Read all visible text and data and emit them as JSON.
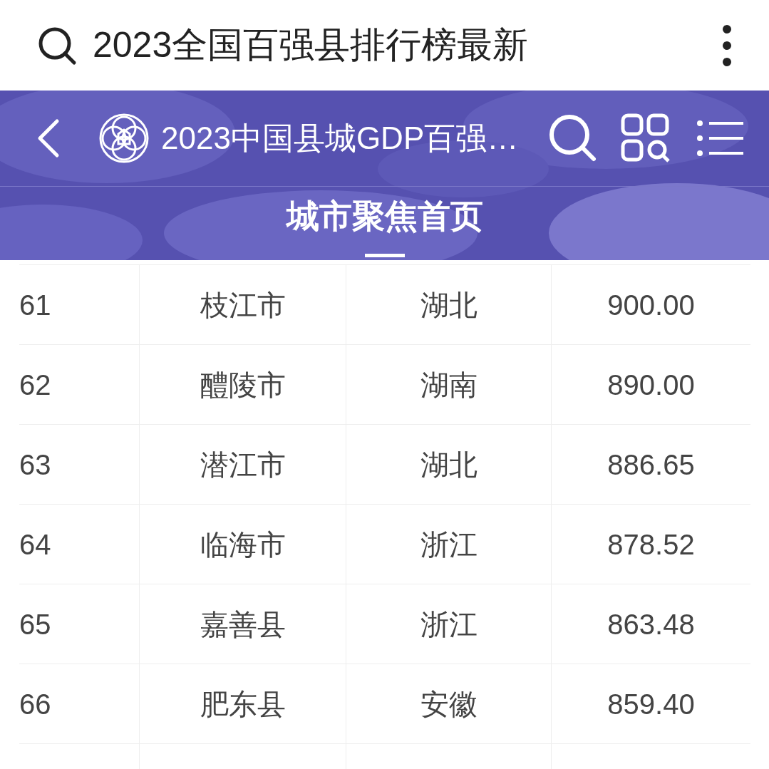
{
  "search_bar": {
    "query": "2023全国百强县排行榜最新"
  },
  "header": {
    "title": "2023中国县城GDP百强…"
  },
  "tabs": [
    {
      "label": "城市聚焦首页",
      "selected": true
    }
  ],
  "table": {
    "rows": [
      {
        "rank": "61",
        "name": "枝江市",
        "province": "湖北",
        "gdp": "900.00"
      },
      {
        "rank": "62",
        "name": "醴陵市",
        "province": "湖南",
        "gdp": "890.00"
      },
      {
        "rank": "63",
        "name": "潜江市",
        "province": "湖北",
        "gdp": "886.65"
      },
      {
        "rank": "64",
        "name": "临海市",
        "province": "浙江",
        "gdp": "878.52"
      },
      {
        "rank": "65",
        "name": "嘉善县",
        "province": "浙江",
        "gdp": "863.48"
      },
      {
        "rank": "66",
        "name": "肥东县",
        "province": "安徽",
        "gdp": "859.40"
      }
    ]
  }
}
